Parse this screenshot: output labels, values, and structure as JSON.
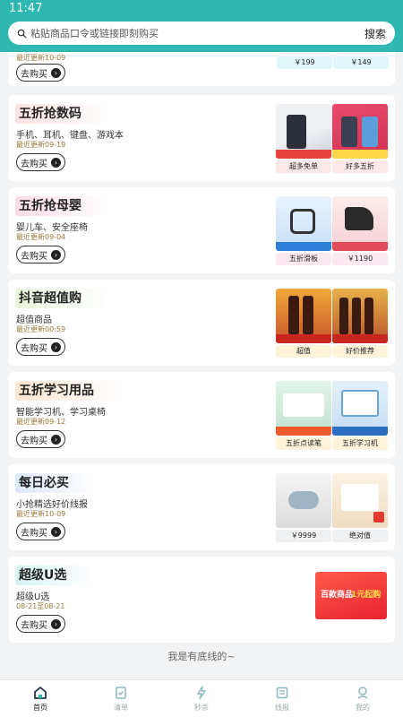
{
  "status": {
    "time": "11:47"
  },
  "search": {
    "placeholder": "粘贴商品口令或链接即刻购买",
    "button": "搜索"
  },
  "buy_label": "去购买",
  "top_card": {
    "date": "最近更新10-09",
    "products": [
      {
        "tag": "￥199"
      },
      {
        "tag": "￥149"
      }
    ]
  },
  "cards": [
    {
      "title": "五折抢数码",
      "sub": "手机、耳机、键盘、游戏本",
      "date": "最近更新09-19",
      "products": [
        {
          "tag": "超多免单"
        },
        {
          "tag": "好多五折"
        }
      ]
    },
    {
      "title": "五折抢母婴",
      "sub": "婴儿车、安全座椅",
      "date": "最近更新09-04",
      "products": [
        {
          "tag": "五折滑板"
        },
        {
          "tag": "￥1190"
        }
      ]
    },
    {
      "title": "抖音超值购",
      "sub": "超值商品",
      "date": "最近更新00:59",
      "products": [
        {
          "tag": "超值"
        },
        {
          "tag": "好价推荐"
        }
      ]
    },
    {
      "title": "五折学习用品",
      "sub": "智能学习机、学习桌椅",
      "date": "最近更新09-12",
      "products": [
        {
          "tag": "五折点读笔"
        },
        {
          "tag": "五折学习机"
        }
      ]
    },
    {
      "title": "每日必买",
      "sub": "小抢精选好价线报",
      "date": "最近更新10-09",
      "products": [
        {
          "tag": "￥9999"
        },
        {
          "tag": "绝对值"
        }
      ]
    },
    {
      "title": "超级U选",
      "sub": "超级U选",
      "date": "08-21至08-21",
      "banner": {
        "line1": "百款商品",
        "line2": "1元起购"
      }
    }
  ],
  "end_text": "我是有底线的~",
  "tabs": [
    {
      "label": "首页",
      "icon": "home-icon"
    },
    {
      "label": "清单",
      "icon": "checklist-icon"
    },
    {
      "label": "秒杀",
      "icon": "flash-sale-icon"
    },
    {
      "label": "线报",
      "icon": "news-icon"
    },
    {
      "label": "我的",
      "icon": "profile-icon"
    }
  ],
  "colors": {
    "header": "#2fb7b2",
    "accent_tag": "#fce8e8",
    "blue_tag": "#dff6fa"
  }
}
